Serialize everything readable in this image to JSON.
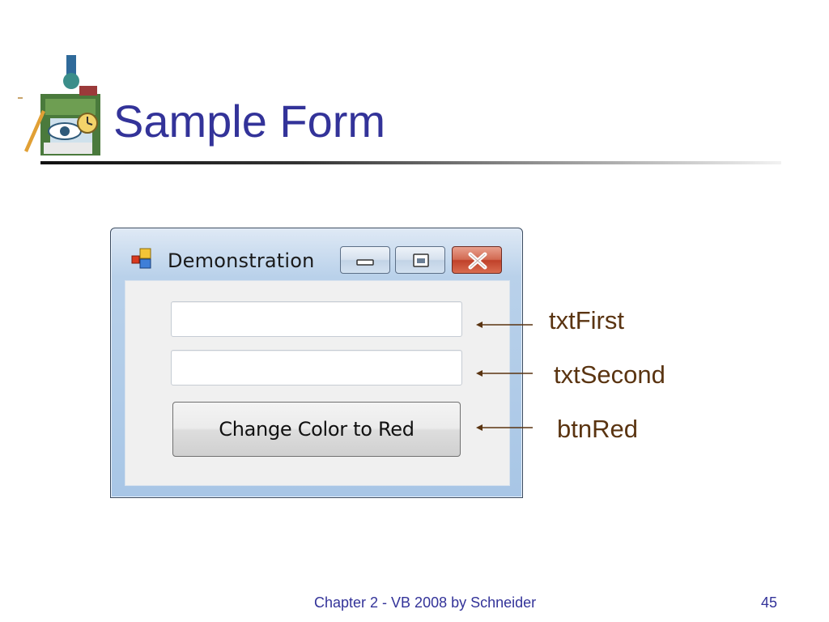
{
  "slide": {
    "title": "Sample Form",
    "footer": "Chapter 2 - VB 2008 by Schneider",
    "page_number": "45"
  },
  "window": {
    "title": "Demonstration",
    "textboxes": [
      {
        "value": "",
        "annotation": "txtFirst"
      },
      {
        "value": "",
        "annotation": "txtSecond"
      }
    ],
    "button": {
      "label": "Change Color to Red",
      "annotation": "btnRed"
    }
  },
  "colors": {
    "title": "#333399",
    "annotation": "#5a3411",
    "close_button": "#c0412a"
  },
  "icons": [
    "logo-clipart",
    "form-icon",
    "minimize-icon",
    "maximize-icon",
    "close-icon",
    "arrow-left-icon"
  ]
}
